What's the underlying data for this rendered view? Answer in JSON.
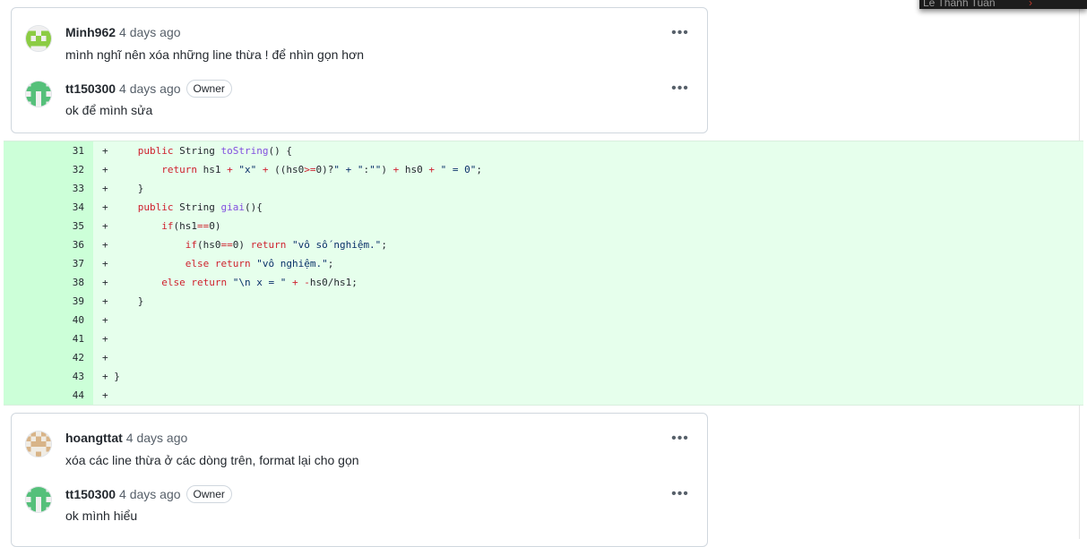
{
  "tooltip": {
    "text": "Lê Thanh Tuấn"
  },
  "threads": [
    {
      "comments": [
        {
          "author": "Minh962",
          "time": "4 days ago",
          "owner_badge": "",
          "text": "mình nghĩ nên xóa những line thừa ! để nhìn gọn hơn",
          "more": "•••"
        },
        {
          "author": "tt150300",
          "time": "4 days ago",
          "owner_badge": "Owner",
          "text": "ok để mình sửa",
          "more": "•••"
        }
      ]
    },
    {
      "comments": [
        {
          "author": "hoangttat",
          "time": "4 days ago",
          "owner_badge": "",
          "text": "xóa các line thừa ở các dòng trên, format lại cho gọn",
          "more": "•••"
        },
        {
          "author": "tt150300",
          "time": "4 days ago",
          "owner_badge": "Owner",
          "text": "ok mình hiểu",
          "more": "•••"
        }
      ]
    }
  ],
  "diff": {
    "lines": [
      {
        "num": "31",
        "segments": [
          [
            "p",
            "+     "
          ],
          [
            "kw",
            "public"
          ],
          [
            "p",
            " String "
          ],
          [
            "fn",
            "toString"
          ],
          [
            "p",
            "() {"
          ]
        ]
      },
      {
        "num": "32",
        "segments": [
          [
            "p",
            "+         "
          ],
          [
            "kw",
            "return"
          ],
          [
            "p",
            " hs1 "
          ],
          [
            "kw",
            "+"
          ],
          [
            "p",
            " "
          ],
          [
            "str",
            "\"x\""
          ],
          [
            "p",
            " "
          ],
          [
            "kw",
            "+"
          ],
          [
            "p",
            " ((hs0"
          ],
          [
            "kw",
            ">="
          ],
          [
            "p",
            "0)?"
          ],
          [
            "str",
            "\" + \""
          ],
          [
            "p",
            ":"
          ],
          [
            "str",
            "\"\""
          ],
          [
            "p",
            ") "
          ],
          [
            "kw",
            "+"
          ],
          [
            "p",
            " hs0 "
          ],
          [
            "kw",
            "+"
          ],
          [
            "p",
            " "
          ],
          [
            "str",
            "\" = 0\""
          ],
          [
            "p",
            ";"
          ]
        ]
      },
      {
        "num": "33",
        "segments": [
          [
            "p",
            "+     }"
          ]
        ]
      },
      {
        "num": "34",
        "segments": [
          [
            "p",
            "+     "
          ],
          [
            "kw",
            "public"
          ],
          [
            "p",
            " String "
          ],
          [
            "fn",
            "giai"
          ],
          [
            "p",
            "(){"
          ]
        ]
      },
      {
        "num": "35",
        "segments": [
          [
            "p",
            "+         "
          ],
          [
            "kw",
            "if"
          ],
          [
            "p",
            "(hs1"
          ],
          [
            "kw",
            "=="
          ],
          [
            "p",
            "0)"
          ]
        ]
      },
      {
        "num": "36",
        "segments": [
          [
            "p",
            "+             "
          ],
          [
            "kw",
            "if"
          ],
          [
            "p",
            "(hs0"
          ],
          [
            "kw",
            "=="
          ],
          [
            "p",
            "0) "
          ],
          [
            "kw",
            "return"
          ],
          [
            "p",
            " "
          ],
          [
            "str",
            "\"vô số nghiệm.\""
          ],
          [
            "p",
            ";"
          ]
        ]
      },
      {
        "num": "37",
        "segments": [
          [
            "p",
            "+             "
          ],
          [
            "kw",
            "else"
          ],
          [
            "p",
            " "
          ],
          [
            "kw",
            "return"
          ],
          [
            "p",
            " "
          ],
          [
            "str",
            "\"vô nghiệm.\""
          ],
          [
            "p",
            ";"
          ]
        ]
      },
      {
        "num": "38",
        "segments": [
          [
            "p",
            "+         "
          ],
          [
            "kw",
            "else"
          ],
          [
            "p",
            " "
          ],
          [
            "kw",
            "return"
          ],
          [
            "p",
            " "
          ],
          [
            "str",
            "\"\\n x = \""
          ],
          [
            "p",
            " "
          ],
          [
            "kw",
            "+"
          ],
          [
            "p",
            " "
          ],
          [
            "kw",
            "-"
          ],
          [
            "p",
            "hs0/hs1;"
          ]
        ]
      },
      {
        "num": "39",
        "segments": [
          [
            "p",
            "+     }"
          ]
        ]
      },
      {
        "num": "40",
        "segments": [
          [
            "p",
            "+"
          ]
        ]
      },
      {
        "num": "41",
        "segments": [
          [
            "p",
            "+"
          ]
        ]
      },
      {
        "num": "42",
        "segments": [
          [
            "p",
            "+"
          ]
        ]
      },
      {
        "num": "43",
        "segments": [
          [
            "p",
            "+ }"
          ]
        ]
      },
      {
        "num": "44",
        "segments": [
          [
            "p",
            "+"
          ]
        ]
      }
    ]
  }
}
